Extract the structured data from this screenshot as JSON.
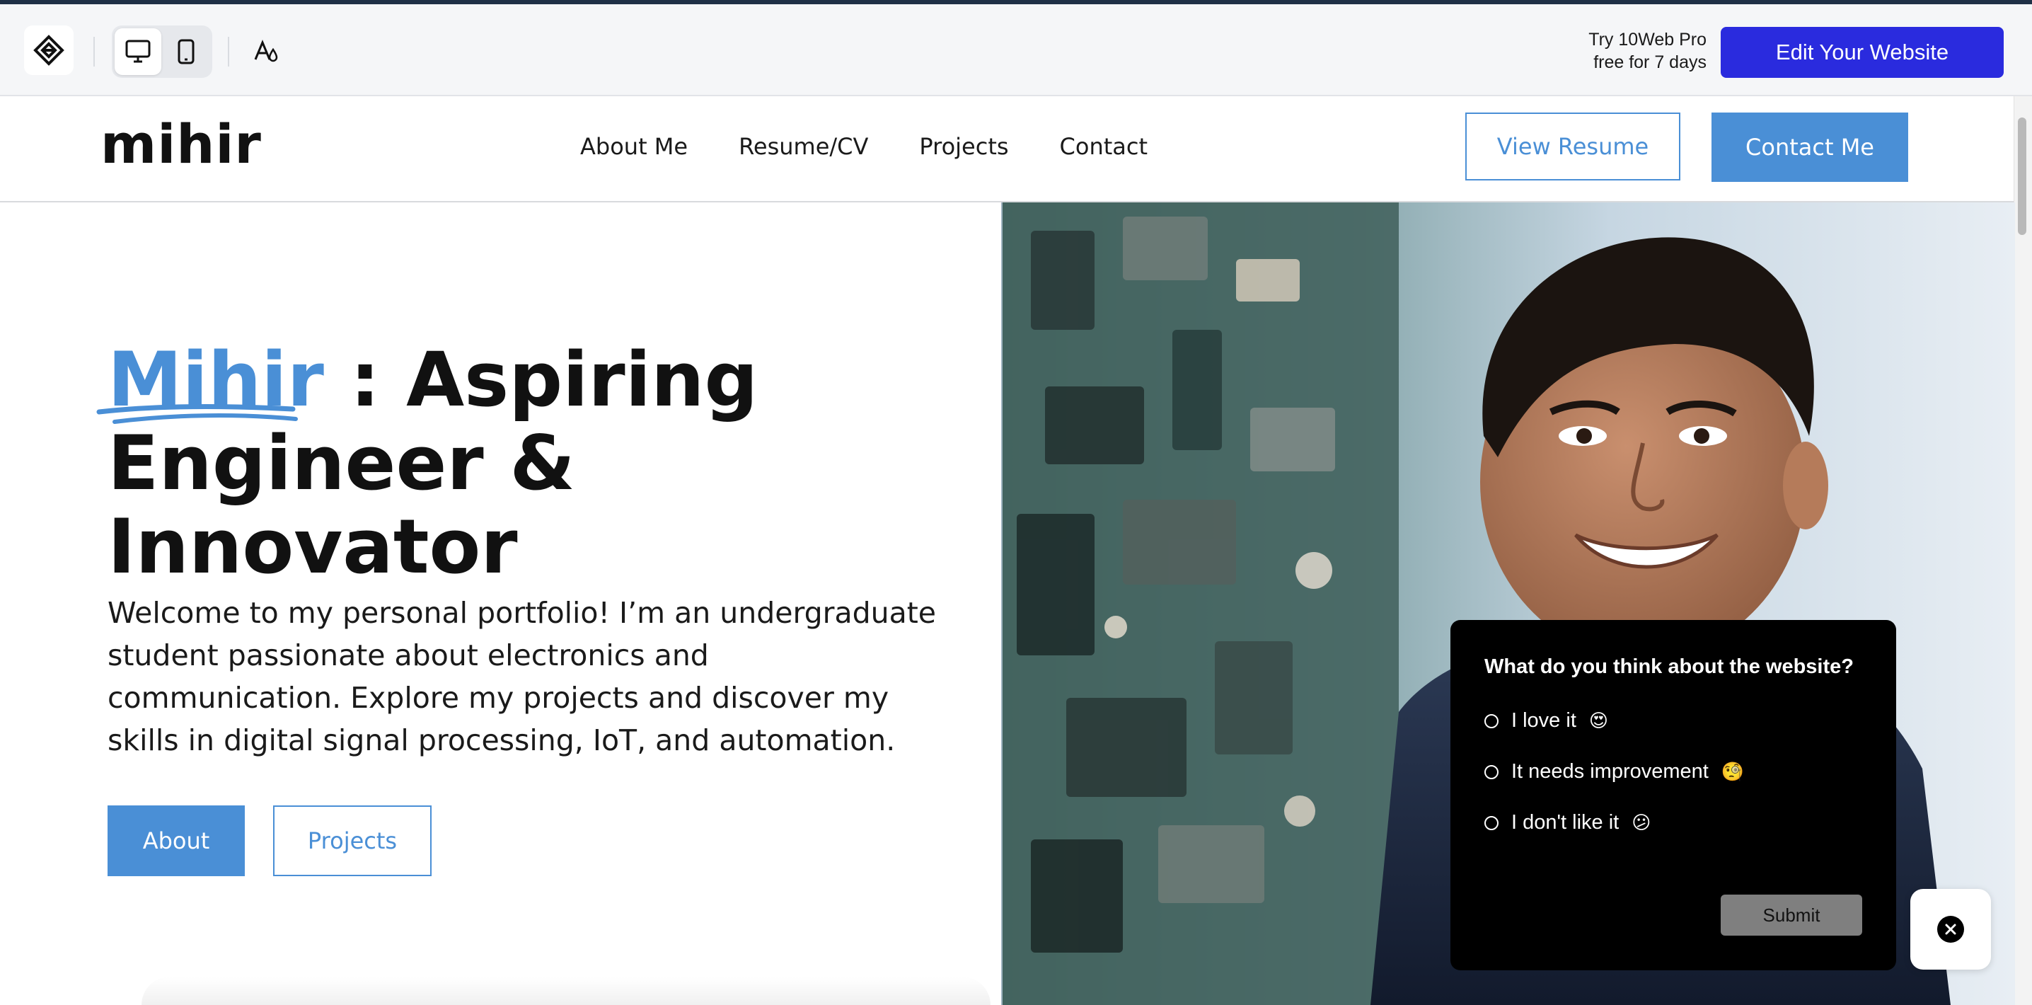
{
  "toolbar": {
    "logo_icon": "10web-diamond-icon",
    "desktop_icon": "desktop-monitor-icon",
    "mobile_icon": "mobile-phone-icon",
    "style_icon": "font-color-drop-icon",
    "trial_line1": "Try 10Web Pro",
    "trial_line2": "free for 7 days",
    "edit_label": "Edit Your Website",
    "edit_color": "#2a2bde"
  },
  "header": {
    "brand": "mihir",
    "nav": [
      "About Me",
      "Resume/CV",
      "Projects",
      "Contact"
    ],
    "view_resume": "View Resume",
    "contact_me": "Contact Me",
    "accent_color": "#4a8fd6"
  },
  "hero": {
    "title_accent": "Mihir",
    "title_rest_1": " : Aspiring",
    "title_rest_2": "Engineer & Innovator",
    "paragraph": "Welcome to my personal portfolio! I’m an undergraduate student passionate about electronics and communication. Explore my projects and discover my skills in digital signal processing, IoT, and automation.",
    "about_button": "About",
    "projects_button": "Projects"
  },
  "survey": {
    "question": "What do you think about the website?",
    "options": [
      {
        "label": "I love it",
        "emoji": "😍"
      },
      {
        "label": "It needs improvement",
        "emoji": "🧐"
      },
      {
        "label": "I don't like it",
        "emoji": "😕"
      }
    ],
    "submit": "Submit",
    "close_icon": "close-icon"
  }
}
